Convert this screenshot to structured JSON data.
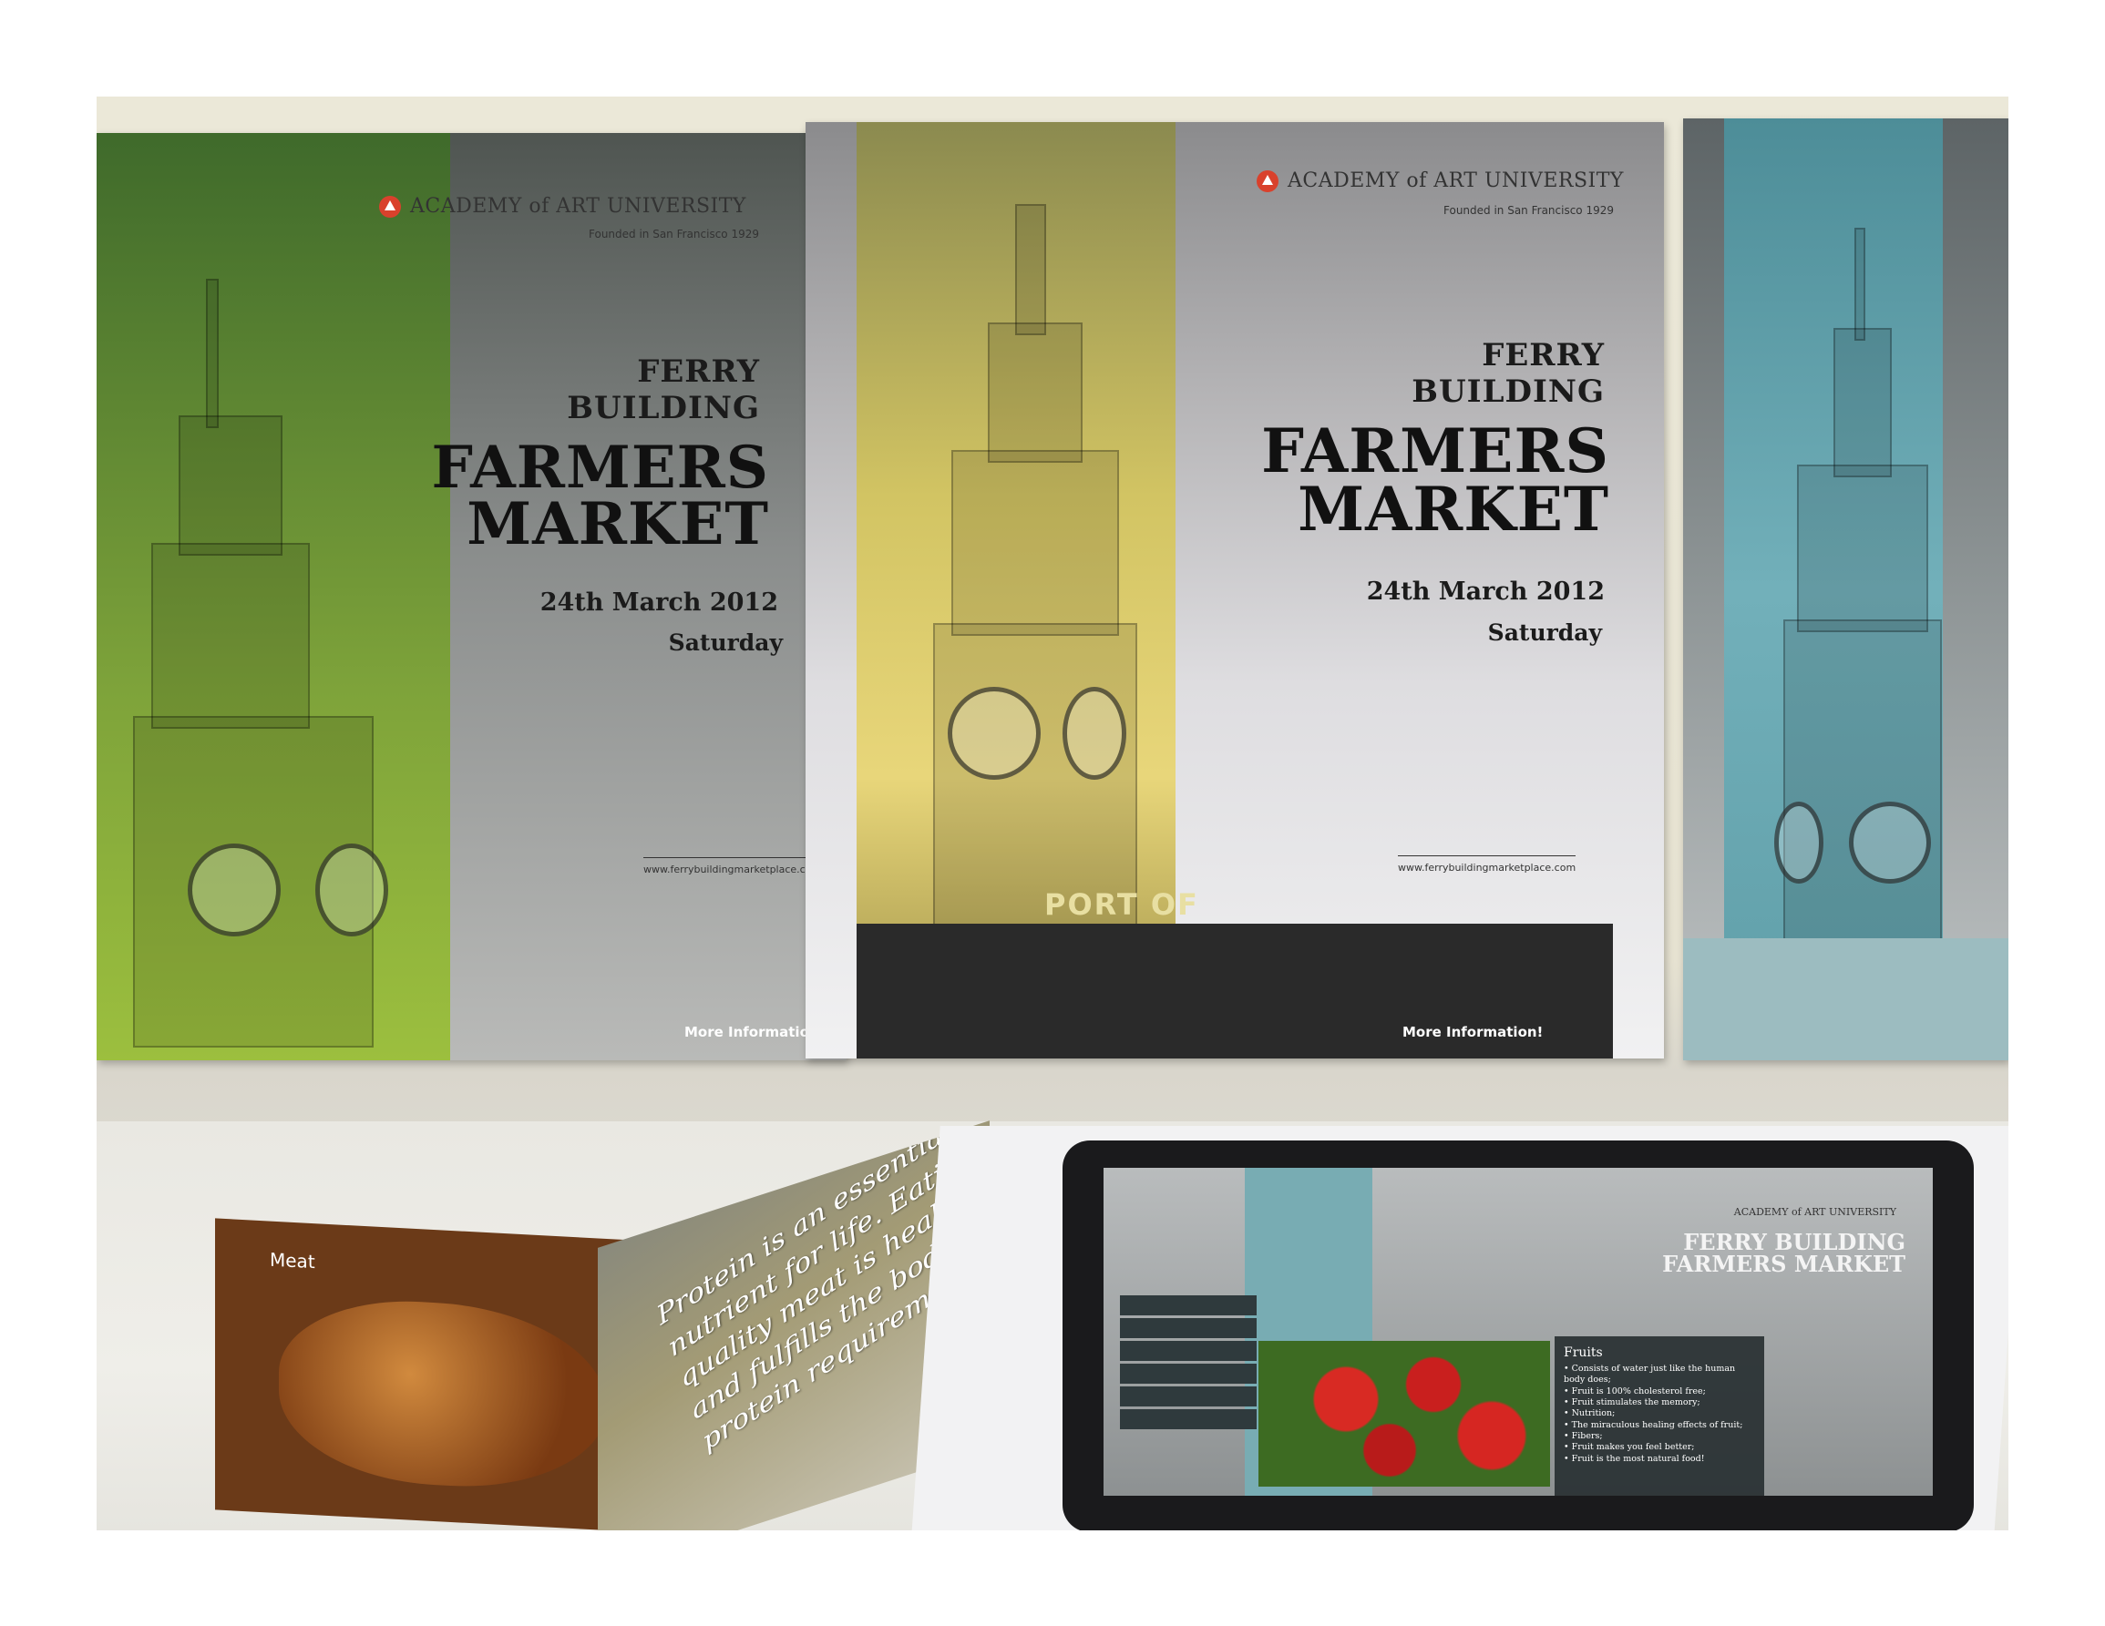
{
  "posters": [
    {
      "name": "green",
      "accent": "#7ea33a",
      "logo": "ACADEMY of ART UNIVERSITY",
      "sub": "Founded in San Francisco 1929",
      "title_small": [
        "FERRY",
        "BUILDING"
      ],
      "title_big": [
        "FARMERS",
        "MARKET"
      ],
      "date": "24th March 2012",
      "day": "Saturday",
      "url": "www.ferrybuildingmarketplace.com",
      "more": "More Information!"
    },
    {
      "name": "yellow",
      "accent": "#e8d67a",
      "logo": "ACADEMY of ART UNIVERSITY",
      "sub": "Founded in San Francisco 1929",
      "title_small": [
        "FERRY",
        "BUILDING"
      ],
      "title_big": [
        "FARMERS",
        "MARKET"
      ],
      "date": "24th March 2012",
      "day": "Saturday",
      "url": "www.ferrybuildingmarketplace.com",
      "more": "More Information!",
      "sign": "PORT OF"
    },
    {
      "name": "teal",
      "accent": "#72b0ba"
    }
  ],
  "booklet": {
    "label": "Meat",
    "quote": "Protein is an essential nutrient for life. Eating quality meat is healthy and fulfills the body's protein requirements."
  },
  "tablet": {
    "logo": "ACADEMY of ART UNIVERSITY",
    "title": [
      "FERRY BUILDING",
      "FARMERS MARKET"
    ],
    "panel_title": "Fruits",
    "panel_items": [
      "• Consists of water just like the human body does;",
      "• Fruit is 100% cholesterol free;",
      "• Fruit stimulates the memory;",
      "• Nutrition;",
      "• The miraculous healing effects of fruit;",
      "• Fibers;",
      "• Fruit makes you feel better;",
      "• Fruit is the most natural food!"
    ]
  }
}
